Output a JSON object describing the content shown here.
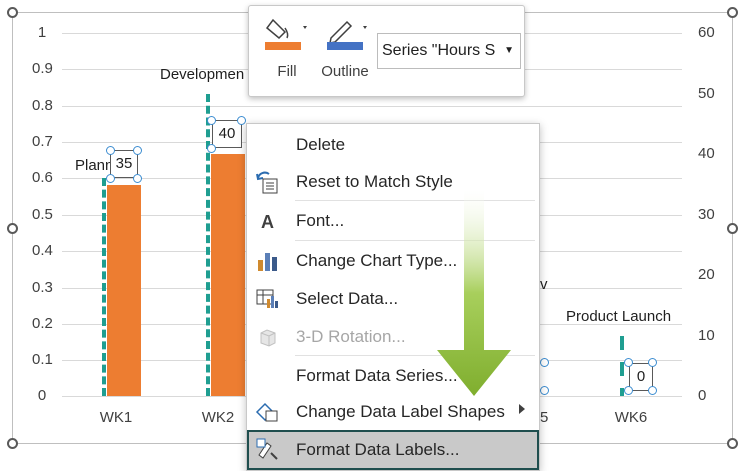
{
  "chart": {
    "left_axis": [
      "1",
      "0.9",
      "0.8",
      "0.7",
      "0.6",
      "0.5",
      "0.4",
      "0.3",
      "0.2",
      "0.1",
      "0"
    ],
    "right_axis": [
      "60",
      "50",
      "40",
      "30",
      "20",
      "10",
      "0"
    ],
    "categories": [
      "WK1",
      "WK2",
      "WK6"
    ],
    "partial_category": "5",
    "milestones": [
      "Planning",
      "Developmen",
      "Product Launch"
    ],
    "partial_milestone": "v",
    "data_labels": [
      "35",
      "40",
      "0"
    ]
  },
  "chart_data": {
    "type": "bar",
    "categories": [
      "WK1",
      "WK2",
      "WK6"
    ],
    "series": [
      {
        "name": "Hours S",
        "values": [
          35,
          40,
          0
        ]
      }
    ],
    "ylim_left": [
      0,
      1
    ],
    "ylim_right": [
      0,
      60
    ]
  },
  "mini_toolbar": {
    "fill_label": "Fill",
    "outline_label": "Outline",
    "series_select": "Series \"Hours S",
    "fill_color": "#ed7d31",
    "outline_color": "#4472c4"
  },
  "context_menu": {
    "items": [
      {
        "label": "Delete",
        "icon": "none"
      },
      {
        "label": "Reset to Match Style",
        "icon": "reset-style-icon"
      },
      {
        "label": "Font...",
        "icon": "font-icon"
      },
      {
        "label": "Change Chart Type...",
        "icon": "chart-type-icon"
      },
      {
        "label": "Select Data...",
        "icon": "select-data-icon"
      },
      {
        "label": "3-D Rotation...",
        "icon": "rotation-3d-icon",
        "disabled": true
      },
      {
        "label": "Format Data Series...",
        "icon": "none"
      },
      {
        "label": "Change Data Label Shapes",
        "icon": "label-shapes-icon",
        "submenu": true
      },
      {
        "label": "Format Data Labels...",
        "icon": "format-labels-icon",
        "highlighted": true
      }
    ]
  },
  "colors": {
    "bar": "#ed7d31",
    "milestone_line": "#1f9e91",
    "highlight_border": "#1f4e4e",
    "arrow": "#8fbf3f"
  }
}
